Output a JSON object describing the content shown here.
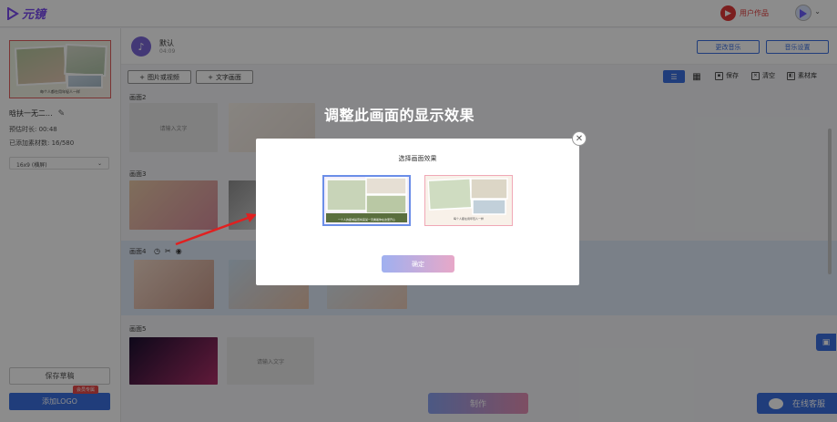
{
  "app": {
    "logo_text": "元镜",
    "user_works_label": "用户作品"
  },
  "sidebar": {
    "project_name": "晗扶一无二...",
    "duration": "预估时长: 00:48",
    "material_count": "已添加素材数: 16/580",
    "ratio_value": "16x9 (横屏)",
    "thumb_caption": "每个人都在用年轻人一样",
    "save_draft_label": "保存草稿",
    "add_logo_label": "添加LOGO",
    "member_badge": "会员专属"
  },
  "music": {
    "name": "默认",
    "time": "04:09",
    "change_music_label": "更改音乐",
    "music_settings_label": "音乐设置"
  },
  "toolbar": {
    "add_image_video_label": "图片或视频",
    "add_text_frame_label": "文字画面",
    "save_label": "保存",
    "clear_label": "清空",
    "library_label": "素材库"
  },
  "scenes": [
    {
      "label": "画面2",
      "text_placeholder": "请输入文字"
    },
    {
      "label": "画面3"
    },
    {
      "label": "画面4"
    },
    {
      "label": "画面5",
      "text_placeholder": "请输入文字"
    }
  ],
  "bottom": {
    "make_label": "制作",
    "service_label": "在线客服"
  },
  "annotation": {
    "text": "调整此画面的显示效果"
  },
  "modal": {
    "title": "选择画面效果",
    "confirm_label": "确定",
    "option1_caption": "一个人的星城是否将来某一天看着你在这里开心"
  },
  "colors": {
    "accent": "#3b6fe0",
    "brand": "#7a4cf0",
    "red": "#e03a3a"
  }
}
